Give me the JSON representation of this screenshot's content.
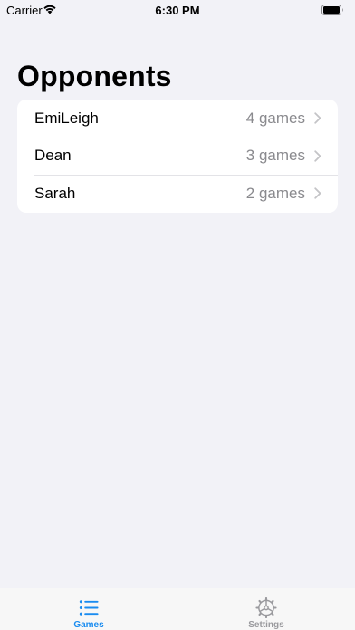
{
  "status_bar": {
    "carrier": "Carrier",
    "time": "6:30 PM",
    "icons": [
      "wifi-icon",
      "battery-icon"
    ]
  },
  "page": {
    "title": "Opponents"
  },
  "opponents": [
    {
      "name": "EmiLeigh",
      "count": "4 games"
    },
    {
      "name": "Dean",
      "count": "3 games"
    },
    {
      "name": "Sarah",
      "count": "2 games"
    }
  ],
  "tab_bar": {
    "tabs": [
      {
        "label": "Games",
        "icon": "list-icon",
        "selected": true
      },
      {
        "label": "Settings",
        "icon": "gear-icon",
        "selected": false
      }
    ],
    "active_color": "#1a8cf0",
    "inactive_color": "#9a9a9e"
  },
  "colors": {
    "background": "#f2f2f7",
    "secondary_text": "#8a8a8e"
  }
}
